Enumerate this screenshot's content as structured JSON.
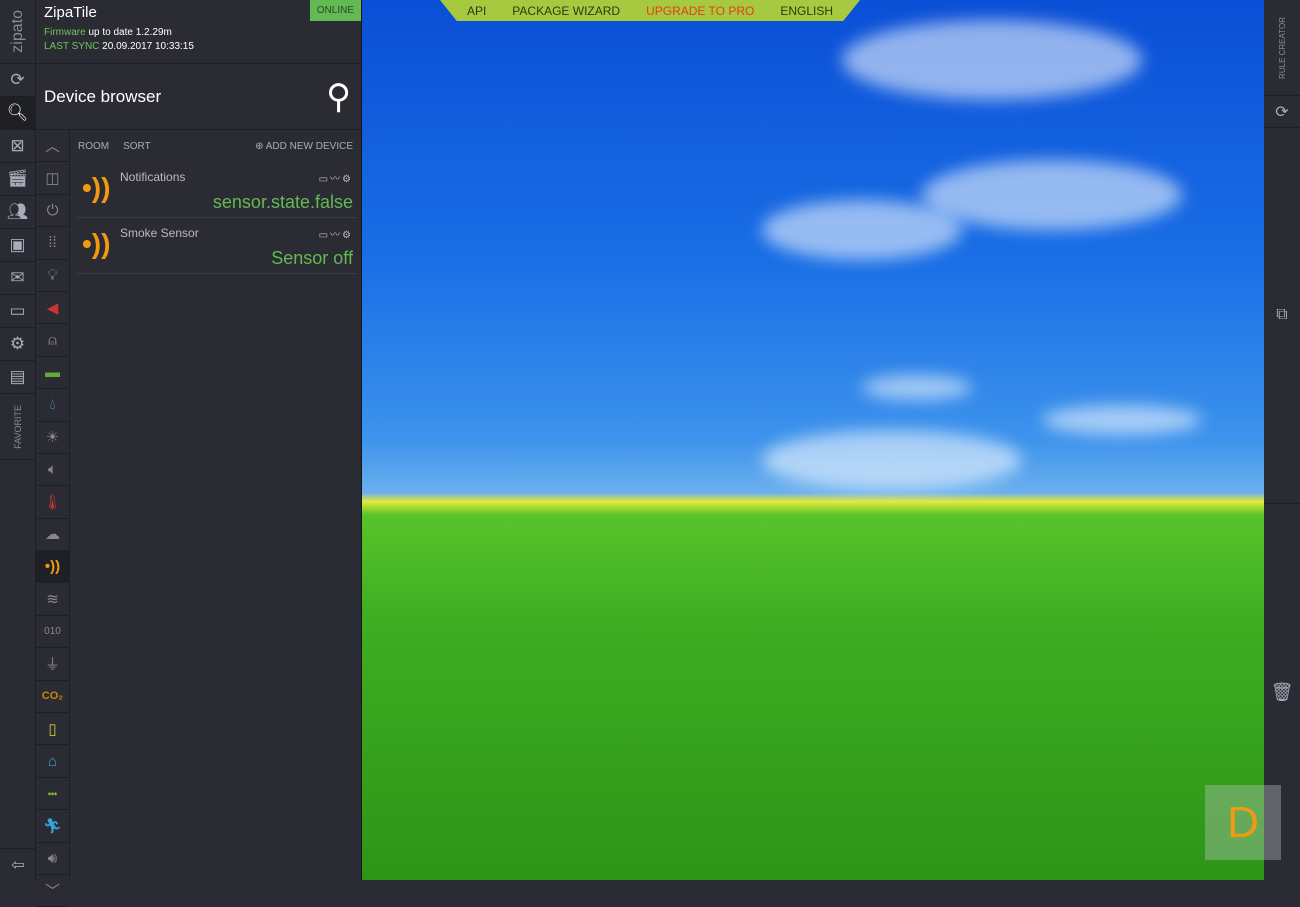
{
  "topbar": {
    "items": [
      "API",
      "PACKAGE WIZARD",
      "UPGRADE TO PRO",
      "ENGLISH"
    ]
  },
  "rail": {
    "logo": "zipato",
    "favorite": "FAVORITE"
  },
  "header": {
    "title": "ZipaTile",
    "status": "ONLINE",
    "firmware_label": "Firmware",
    "firmware_value": "up to date 1.2.29m",
    "sync_label": "LAST SYNC",
    "sync_value": "20.09.2017 10:33:15"
  },
  "browser": {
    "title": "Device browser"
  },
  "toolbar": {
    "room": "ROOM",
    "sort": "SORT",
    "add": "ADD NEW DEVICE"
  },
  "devices": [
    {
      "name": "Notifications",
      "value": "sensor.state.false"
    },
    {
      "name": "Smoke Sensor",
      "value": "Sensor off"
    }
  ],
  "right": {
    "rule_creator": "RULE CREATOR"
  },
  "badge": "D",
  "colors": {
    "accent": "#63b954",
    "orange": "#f29a0f",
    "topbar": "#a7c93f",
    "pro": "#e0401a"
  }
}
